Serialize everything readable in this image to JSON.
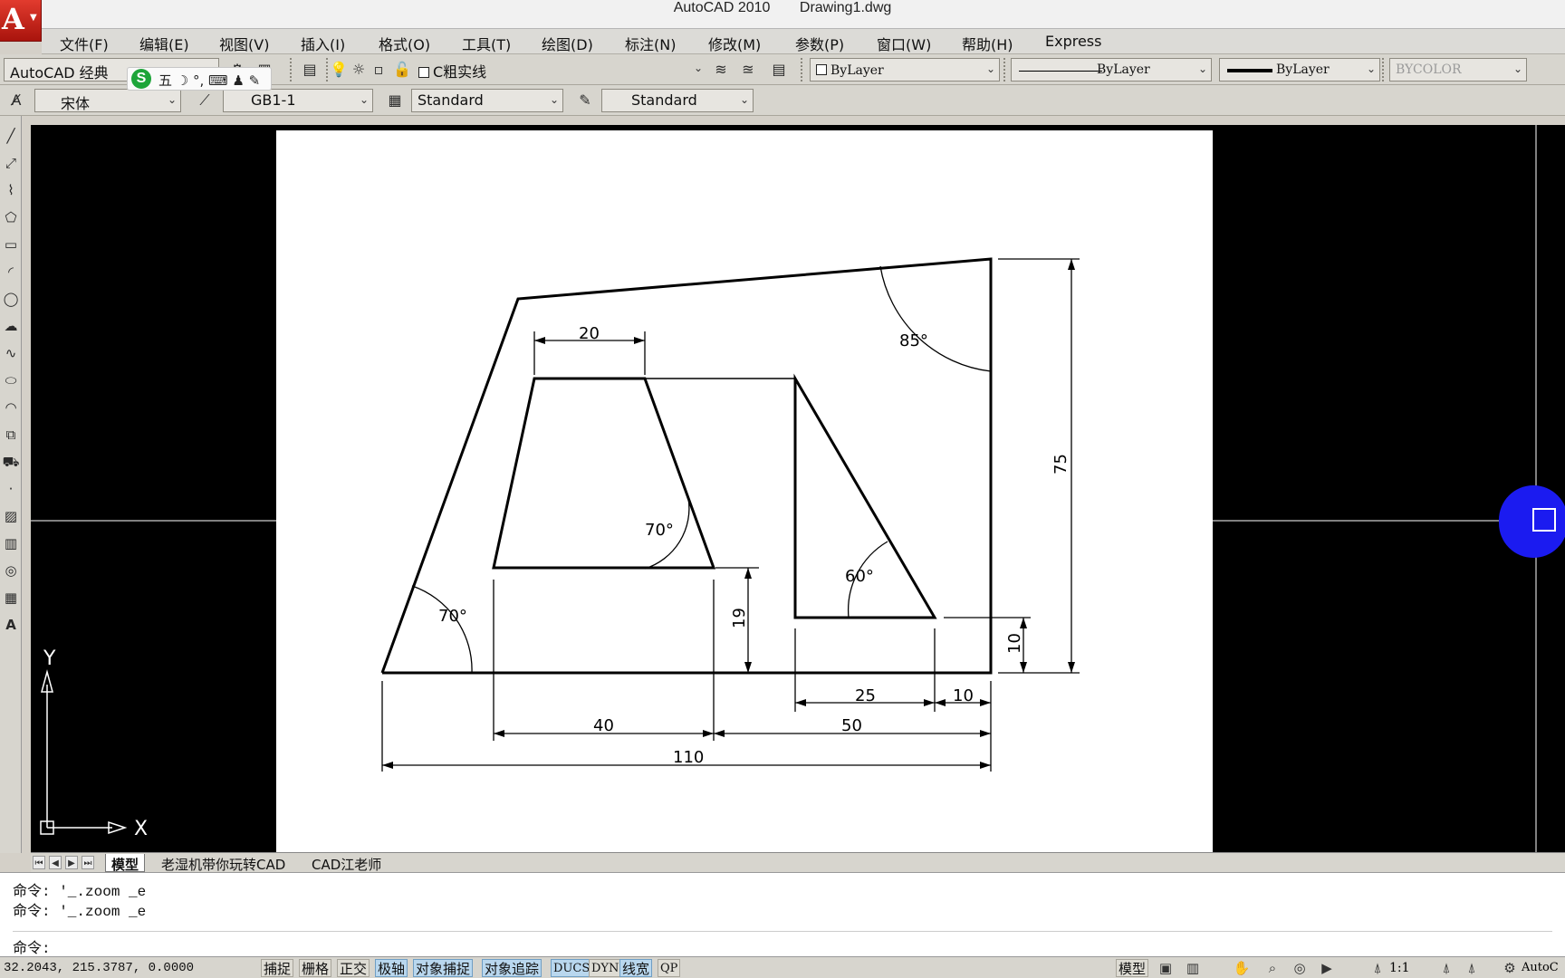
{
  "title": {
    "app": "AutoCAD 2010",
    "file": "Drawing1.dwg"
  },
  "menu": [
    "文件(F)",
    "编辑(E)",
    "视图(V)",
    "插入(I)",
    "格式(O)",
    "工具(T)",
    "绘图(D)",
    "标注(N)",
    "修改(M)",
    "参数(P)",
    "窗口(W)",
    "帮助(H)",
    "Express"
  ],
  "toolbar1": {
    "workspace": "AutoCAD 经典",
    "layer": "C粗实线",
    "color": "ByLayer",
    "linetype": "ByLayer",
    "lineweight": "ByLayer",
    "plotstyle": "BYCOLOR"
  },
  "ime": {
    "logo": "S",
    "text": "五 ☽ °, ⌨ ♟ ✎"
  },
  "toolbar2": {
    "text_style_font": "宋体",
    "dim_style": "GB1-1",
    "table_style": "Standard",
    "multileader_style": "Standard"
  },
  "drawing": {
    "dimensions": [
      "20",
      "85°",
      "75",
      "70°",
      "60°",
      "19",
      "10",
      "70°",
      "25",
      "10",
      "40",
      "50",
      "110"
    ],
    "ucs": {
      "y": "Y",
      "x": "X"
    }
  },
  "tabs": [
    "模型",
    "老湿机带你玩转CAD",
    "CAD江老师"
  ],
  "command": {
    "history": [
      "命令: '_.zoom _e",
      "命令: '_.zoom _e"
    ],
    "prompt": "命令:"
  },
  "status": {
    "coords": "32.2043, 215.3787, 0.0000",
    "toggles": [
      {
        "label": "捕捉",
        "on": false
      },
      {
        "label": "栅格",
        "on": false
      },
      {
        "label": "正交",
        "on": false
      },
      {
        "label": "极轴",
        "on": true
      },
      {
        "label": "对象捕捉",
        "on": true
      },
      {
        "label": "对象追踪",
        "on": true
      },
      {
        "label": "DUCS",
        "on": true
      },
      {
        "label": "DYN",
        "on": false
      },
      {
        "label": "线宽",
        "on": true
      },
      {
        "label": "QP",
        "on": false
      }
    ],
    "model": "模型",
    "scale": "1:1",
    "right_label": "AutoC"
  },
  "colors": {
    "canvas": "#000000",
    "paper": "#ffffff",
    "toggle_on": "#b9d7ee",
    "nav_disc": "#1b1bf0"
  }
}
